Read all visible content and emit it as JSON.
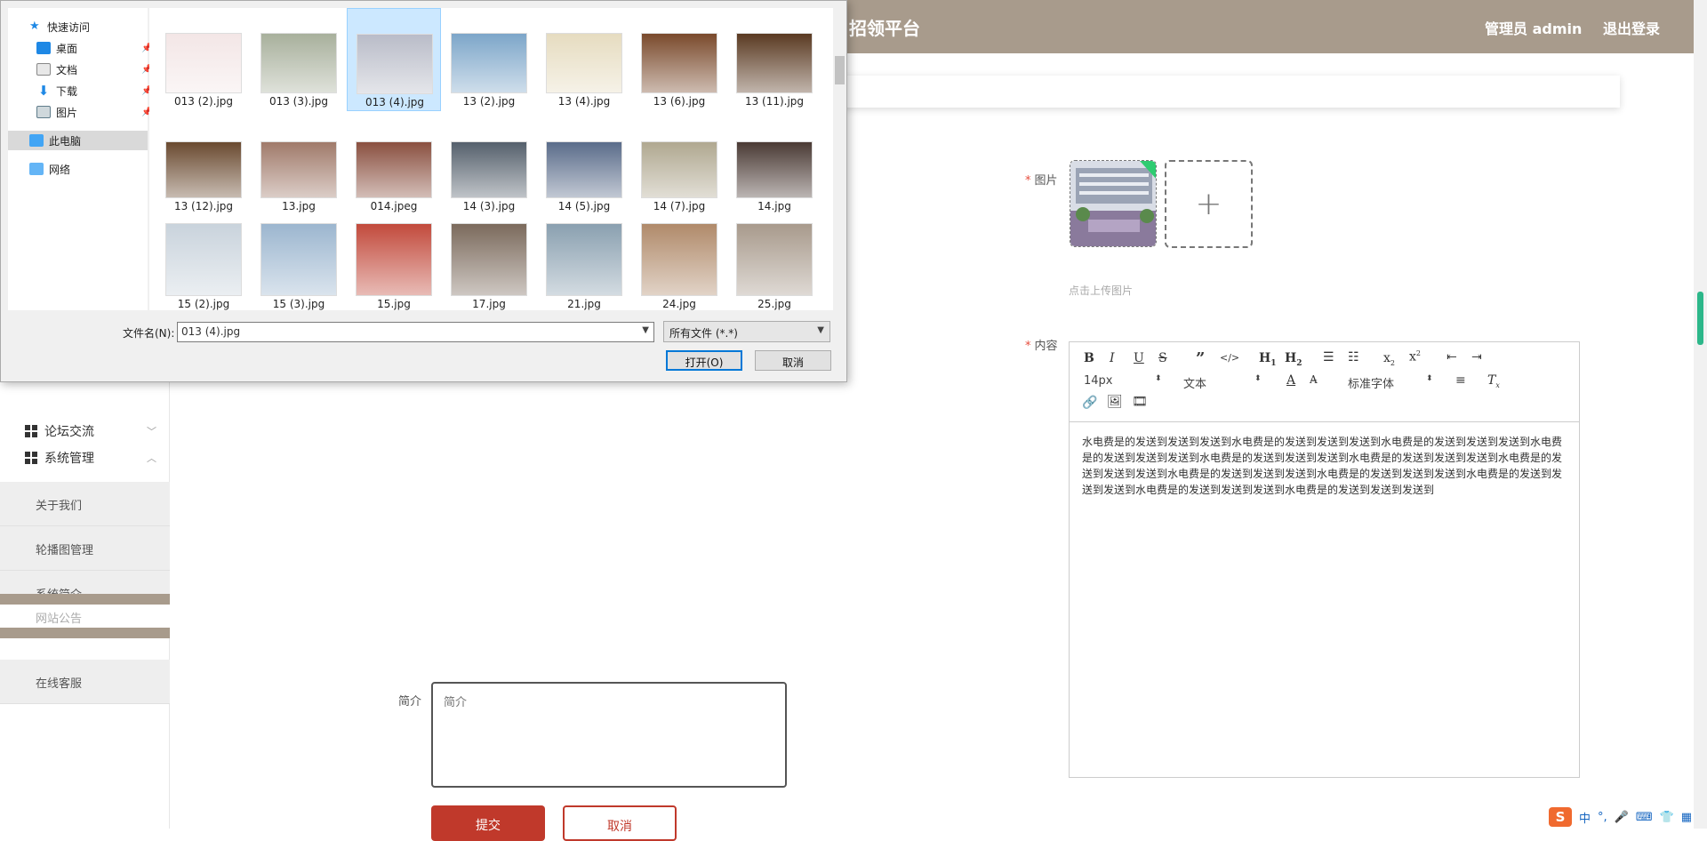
{
  "header": {
    "brand": "招领平台",
    "admin": "管理员 admin",
    "logout": "退出登录"
  },
  "sidebar": {
    "forum": "论坛交流",
    "system": "系统管理",
    "items": [
      "关于我们",
      "轮播图管理",
      "系统简介",
      "网站公告",
      "在线客服"
    ]
  },
  "form": {
    "image_label": "图片",
    "upload_tip": "点击上传图片",
    "content_label": "内容",
    "intro_label": "简介",
    "intro_placeholder": "简介",
    "submit": "提交",
    "cancel": "取消"
  },
  "editor": {
    "font_size": "14px",
    "block_type": "文本",
    "font_family": "标准字体",
    "content": "水电费是的发送到发送到发送到水电费是的发送到发送到发送到水电费是的发送到发送到发送到水电费是的发送到发送到发送到水电费是的发送到发送到发送到水电费是的发送到发送到发送到水电费是的发送到发送到发送到水电费是的发送到发送到发送到水电费是的发送到发送到发送到水电费是的发送到发送到发送到水电费是的发送到发送到发送到水电费是的发送到发送到发送到"
  },
  "dialog": {
    "nav": {
      "quick_access": "快速访问",
      "desktop": "桌面",
      "documents": "文档",
      "downloads": "下载",
      "pictures": "图片",
      "this_pc": "此电脑",
      "network": "网络"
    },
    "files": [
      {
        "name": "013 (2).jpg",
        "color": "#f3e6e6"
      },
      {
        "name": "013 (3).jpg",
        "color": "#a8b09c"
      },
      {
        "name": "013 (4).jpg",
        "color": "#b9bcc8"
      },
      {
        "name": "13 (2).jpg",
        "color": "#7da6c9"
      },
      {
        "name": "13 (4).jpg",
        "color": "#e6dcc0"
      },
      {
        "name": "13 (6).jpg",
        "color": "#7a4a2c"
      },
      {
        "name": "13 (11).jpg",
        "color": "#5a3a22"
      },
      {
        "name": "13 (12).jpg",
        "color": "#6a4a30"
      },
      {
        "name": "13.jpg",
        "color": "#a07a6a"
      },
      {
        "name": "014.jpeg",
        "color": "#8a5040"
      },
      {
        "name": "14 (3).jpg",
        "color": "#55606c"
      },
      {
        "name": "14 (5).jpg",
        "color": "#5a6c8a"
      },
      {
        "name": "14 (7).jpg",
        "color": "#b0a890"
      },
      {
        "name": "14.jpg",
        "color": "#4a3a34"
      },
      {
        "name": "15 (2).jpg",
        "color": "#c9d3dc"
      },
      {
        "name": "15 (3).jpg",
        "color": "#9cb6cf"
      },
      {
        "name": "15.jpg",
        "color": "#c24a3c"
      },
      {
        "name": "17.jpg",
        "color": "#7b6a5c"
      },
      {
        "name": "21.jpg",
        "color": "#8aa0b0"
      },
      {
        "name": "24.jpg",
        "color": "#b08a6a"
      },
      {
        "name": "25.jpg",
        "color": "#a89a8c"
      }
    ],
    "filename_label": "文件名(N):",
    "filename_value": "013 (4).jpg",
    "filetype": "所有文件 (*.*)",
    "open": "打开(O)",
    "cancel": "取消"
  },
  "tray": {
    "ime": "中",
    "sogou": "S"
  },
  "colors": {
    "header_bg": "#a89b8c",
    "submit_bg": "#c0392b",
    "dialog_selection": "#cce8ff"
  }
}
